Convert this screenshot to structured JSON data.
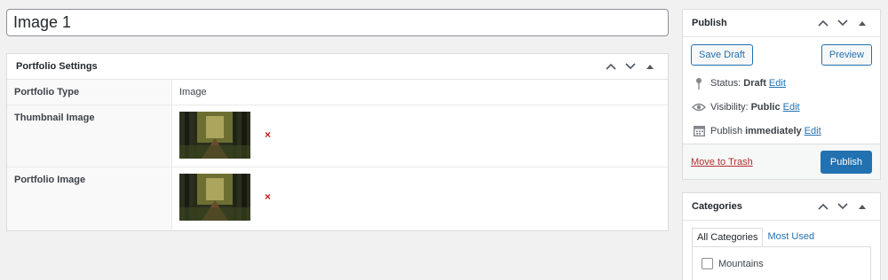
{
  "title_field": {
    "value": "Image 1"
  },
  "portfolio_settings": {
    "title": "Portfolio Settings",
    "rows": [
      {
        "label": "Portfolio Type",
        "value": "Image"
      },
      {
        "label": "Thumbnail Image",
        "remove": "×"
      },
      {
        "label": "Portfolio Image",
        "remove": "×"
      }
    ]
  },
  "publish": {
    "title": "Publish",
    "save_draft": "Save Draft",
    "preview": "Preview",
    "status_label": "Status:",
    "status_value": "Draft",
    "visibility_label": "Visibility:",
    "visibility_value": "Public",
    "publish_label": "Publish",
    "publish_value": "immediately",
    "edit": "Edit",
    "trash": "Move to Trash",
    "publish_button": "Publish"
  },
  "categories": {
    "title": "Categories",
    "tabs": [
      "All Categories",
      "Most Used"
    ],
    "items": [
      "Mountains"
    ]
  },
  "colors": {
    "accent": "#2271b1",
    "danger": "#cc1818",
    "trash": "#b32d2e"
  }
}
